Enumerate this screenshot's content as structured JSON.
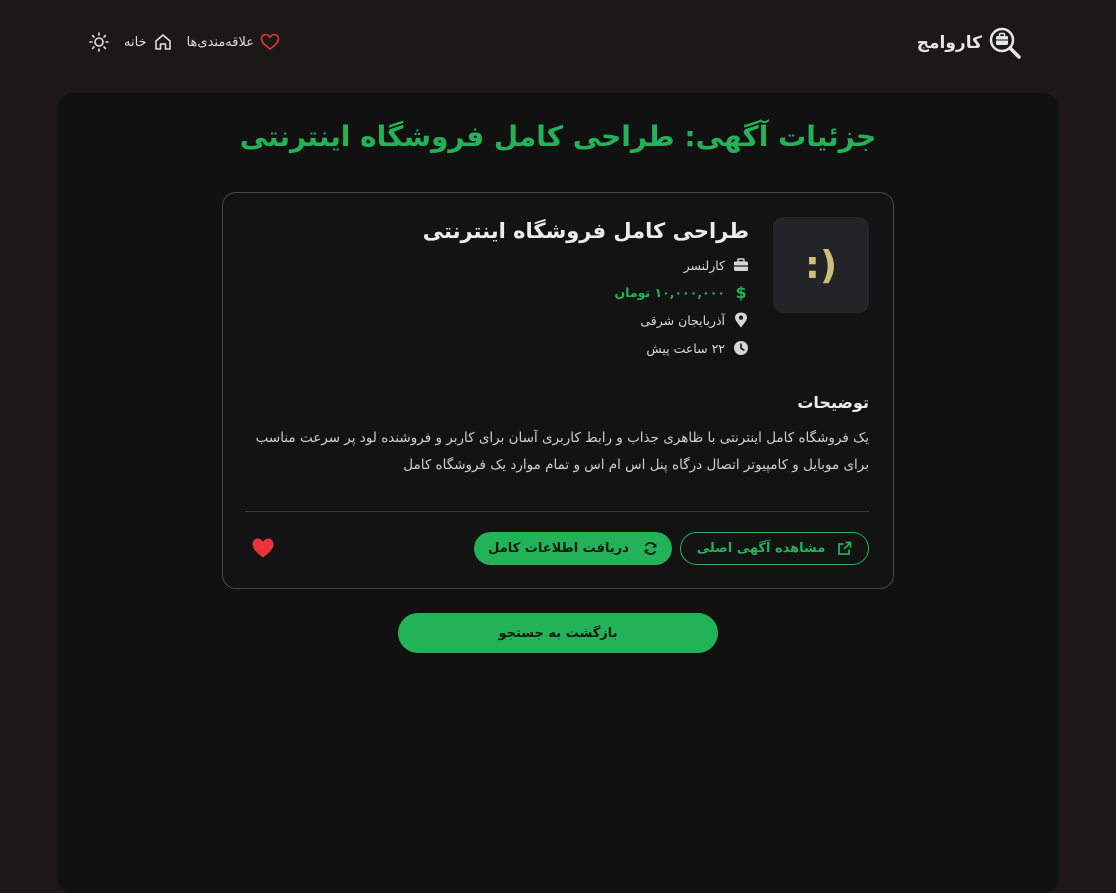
{
  "brand": {
    "name": "کاروامج",
    "logo_icon": "briefcase-magnifier-icon"
  },
  "nav": {
    "favorites_label": "علاقه‌مندی‌ها",
    "home_label": "خانه",
    "theme_icon": "sun-icon"
  },
  "page": {
    "title": "جزئیات آگهی: طراحی کامل فروشگاه اینترنتی"
  },
  "job": {
    "thumbnail_text": ":)",
    "title": "طراحی کامل فروشگاه اینترنتی",
    "company": "کارلنسر",
    "salary": "۱۰,۰۰۰,۰۰۰ تومان",
    "location": "آذربایجان شرقی",
    "posted": "۲۲ ساعت پیش",
    "description_heading": "توضیحات",
    "description": "یک فروشگاه کامل اینترنتی با ظاهری جذاب و رابط کاربری آسان برای کاربر و فروشنده لود پر سرعت مناسب برای موبایل و کامپیوتر اتصال درگاه پنل اس ام اس و تمام موارد یک فروشگاه کامل"
  },
  "actions": {
    "view_original_label": "مشاهده آگهی اصلی",
    "full_info_label": "دریافت اطلاعات کامل",
    "back_label": "بازگشت به جستجو"
  },
  "colors": {
    "accent": "#22b257",
    "favorite": "#e8333a",
    "background": "#1b1817",
    "panel": "#121111"
  }
}
